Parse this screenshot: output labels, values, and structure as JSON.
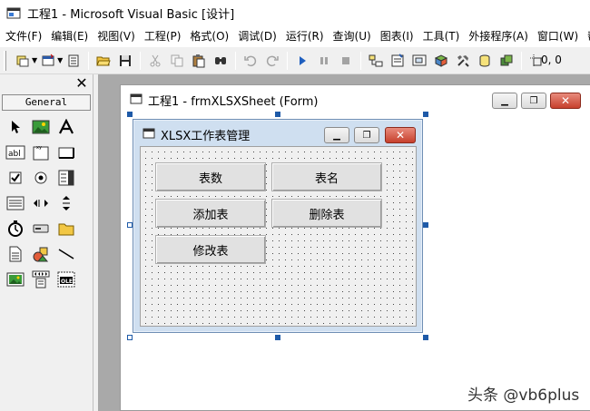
{
  "app": {
    "title": "工程1 - Microsoft Visual Basic [设计]",
    "icon": "vb-app-icon"
  },
  "menu": {
    "items": [
      {
        "label": "文件(F)"
      },
      {
        "label": "编辑(E)"
      },
      {
        "label": "视图(V)"
      },
      {
        "label": "工程(P)"
      },
      {
        "label": "格式(O)"
      },
      {
        "label": "调试(D)"
      },
      {
        "label": "运行(R)"
      },
      {
        "label": "查询(U)"
      },
      {
        "label": "图表(I)"
      },
      {
        "label": "工具(T)"
      },
      {
        "label": "外接程序(A)"
      },
      {
        "label": "窗口(W)"
      },
      {
        "label": "帮助"
      }
    ]
  },
  "toolbar": {
    "coordinates": "0, 0"
  },
  "toolbox": {
    "tab_label": "General",
    "close_glyph": "✕"
  },
  "design_window": {
    "title": "工程1 - frmXLSXSheet (Form)"
  },
  "form": {
    "title": "XLSX工作表管理",
    "buttons": [
      {
        "label": "表数"
      },
      {
        "label": "表名"
      },
      {
        "label": "添加表"
      },
      {
        "label": "删除表"
      },
      {
        "label": "修改表"
      }
    ]
  },
  "watermark": "头条 @vb6plus",
  "colors": {
    "selection_handle": "#1e5aa8",
    "close_button": "#c7402d",
    "form_border": "#6f8fb5"
  }
}
